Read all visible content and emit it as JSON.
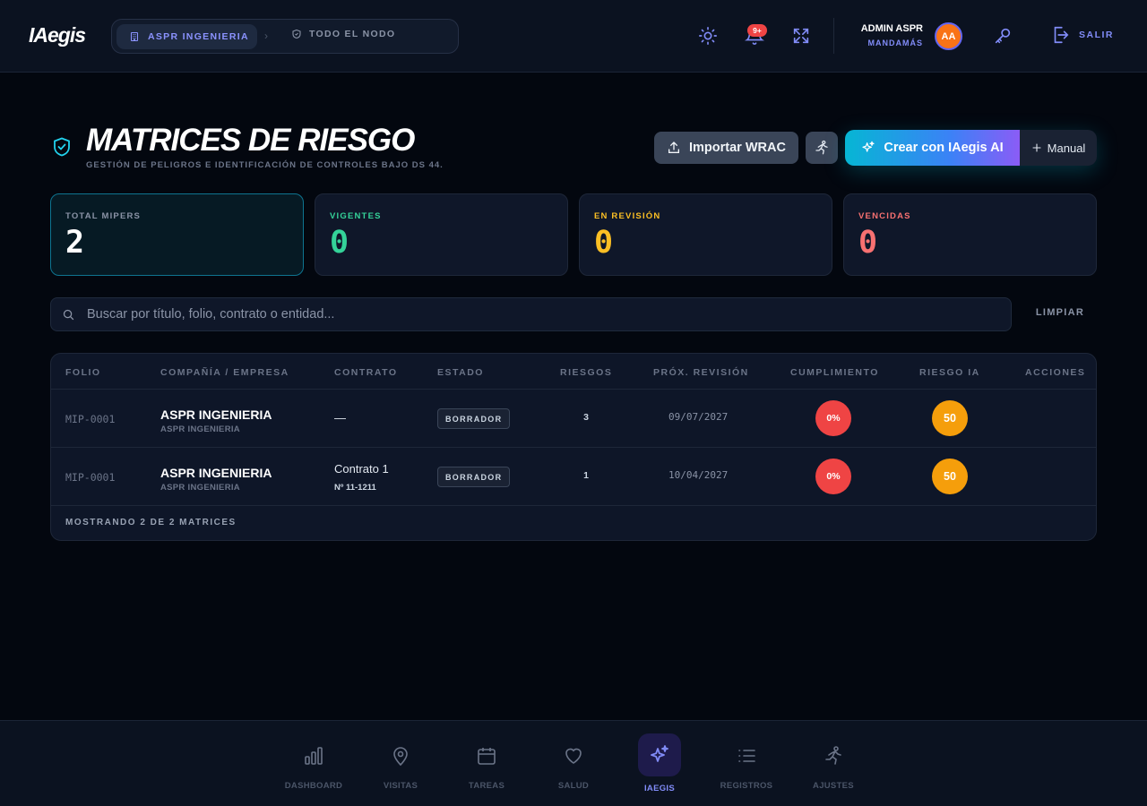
{
  "header": {
    "logo": "IAegis",
    "breadcrumb": {
      "company": "ASPR INGENIERIA",
      "scope": "TODO EL NODO"
    },
    "notifications_badge": "9+",
    "user": {
      "name": "ADMIN ASPR",
      "role": "MANDAMÁS",
      "initials": "AA"
    },
    "logout_label": "SALIR"
  },
  "page": {
    "title": "MATRICES DE RIESGO",
    "subtitle": "GESTIÓN DE PELIGROS E IDENTIFICACIÓN DE CONTROLES BAJO DS 44.",
    "import_label": "Importar WRAC",
    "ai_label": "Crear con IAegis AI",
    "manual_label": "Manual"
  },
  "stats": [
    {
      "label": "TOTAL MIPERS",
      "value": "2",
      "color": "#ffffff",
      "label_color": "#8a93a6"
    },
    {
      "label": "VIGENTES",
      "value": "0",
      "color": "#34d399",
      "label_color": "#34d399"
    },
    {
      "label": "EN REVISIÓN",
      "value": "0",
      "color": "#fbbf24",
      "label_color": "#fbbf24"
    },
    {
      "label": "VENCIDAS",
      "value": "0",
      "color": "#f87171",
      "label_color": "#f87171"
    }
  ],
  "search": {
    "placeholder": "Buscar por título, folio, contrato o entidad...",
    "clear_label": "LIMPIAR"
  },
  "table": {
    "columns": [
      "FOLIO",
      "COMPAÑÍA / EMPRESA",
      "CONTRATO",
      "ESTADO",
      "RIESGOS",
      "PRÓX. REVISIÓN",
      "CUMPLIMIENTO",
      "RIESGO IA",
      "ACCIONES"
    ],
    "rows": [
      {
        "folio": "MIP-0001",
        "company": "ASPR INGENIERIA",
        "company_sub": "ASPR INGENIERIA",
        "contract": "—",
        "contract_sub": "",
        "status": "BORRADOR",
        "risks": "3",
        "next_review": "09/07/2027",
        "compliance": "0%",
        "ai_risk": "50"
      },
      {
        "folio": "MIP-0001",
        "company": "ASPR INGENIERIA",
        "company_sub": "ASPR INGENIERIA",
        "contract": "Contrato 1",
        "contract_sub": "Nº 11-1211",
        "status": "BORRADOR",
        "risks": "1",
        "next_review": "10/04/2027",
        "compliance": "0%",
        "ai_risk": "50"
      }
    ],
    "footer": "MOSTRANDO 2 DE 2 MATRICES"
  },
  "bottom_nav": [
    {
      "label": "DASHBOARD",
      "icon": "bar-chart-icon"
    },
    {
      "label": "VISITAS",
      "icon": "map-pin-icon"
    },
    {
      "label": "TAREAS",
      "icon": "calendar-icon"
    },
    {
      "label": "SALUD",
      "icon": "heart-icon"
    },
    {
      "label": "IAEGIS",
      "icon": "sparkles-icon",
      "active": true
    },
    {
      "label": "REGISTROS",
      "icon": "list-icon"
    },
    {
      "label": "AJUSTES",
      "icon": "running-person-icon"
    }
  ],
  "colors": {
    "accent": "#818cf8",
    "danger": "#ef4444",
    "warning": "#f59e0b",
    "ai_gradient_start": "#06b6d4",
    "ai_gradient_end": "#8b5cf6"
  }
}
